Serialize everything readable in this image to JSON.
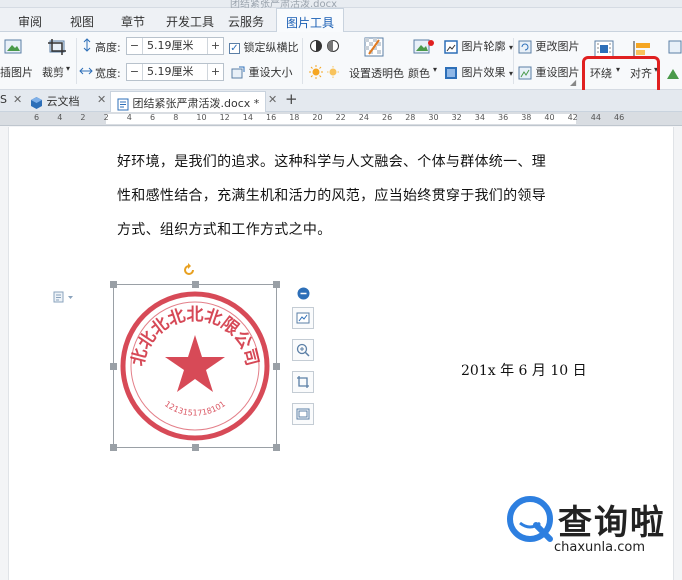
{
  "window": {
    "title_fragment": "团结紧张严肃活泼.docx"
  },
  "menu": {
    "tabs": [
      "审阅",
      "视图",
      "章节",
      "开发工具",
      "云服务",
      "图片工具"
    ],
    "active_tab": "图片工具"
  },
  "ribbon": {
    "insert_picture": "插图片",
    "crop": "裁剪",
    "height_label": "高度:",
    "height_value": "5.19厘米",
    "width_label": "宽度:",
    "width_value": "5.19厘米",
    "lock_ratio": "锁定纵横比",
    "reset_size": "重设大小",
    "set_transparent": "设置透明色",
    "color": "颜色",
    "picture_outline": "图片轮廓",
    "picture_effect": "图片效果",
    "change_picture": "更改图片",
    "reset_picture": "重设图片",
    "wrap": "环绕",
    "align": "对齐"
  },
  "doc_tabs": {
    "first": "S",
    "cloud_docs": "云文档",
    "active_doc": "团结紧张严肃活泼.docx *",
    "add": "+"
  },
  "ruler": {
    "numbers": [
      "6",
      "4",
      "2",
      "2",
      "4",
      "6",
      "8",
      "10",
      "12",
      "14",
      "16",
      "18",
      "20",
      "22",
      "24",
      "26",
      "28",
      "30",
      "32",
      "34",
      "36",
      "38",
      "40",
      "42",
      "44",
      "46"
    ]
  },
  "document": {
    "lines": [
      "好环境，是我们的追求。这种科学与人文融会、个体与群体统一、理",
      "性和感性结合，充满生机和活力的风范，应当始终贯穿于我们的领导",
      "方式、组织方式和工作方式之中。"
    ],
    "date": "201x 年 6 月 10 日"
  },
  "stamp": {
    "text": "北北北北北北限公司",
    "serial": "1213151718101",
    "color": "#d02a3a"
  },
  "watermark": {
    "name": "查询啦",
    "url": "chaxunla.com"
  },
  "colors": {
    "accent": "#1a5fb4",
    "highlight": "#e02020"
  }
}
